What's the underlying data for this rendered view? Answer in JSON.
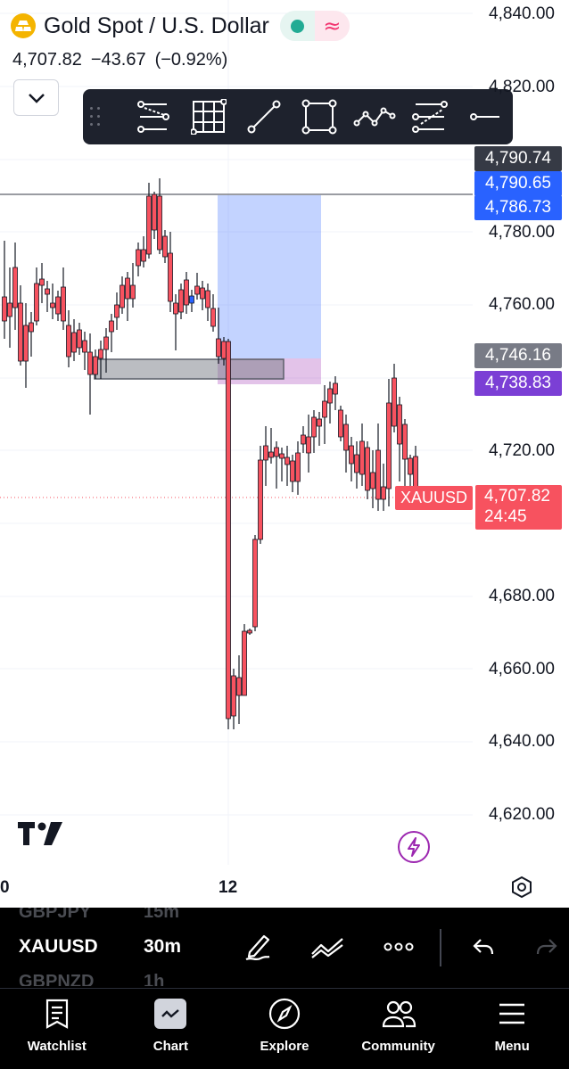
{
  "header": {
    "title": "Gold Spot / U.S. Dollar",
    "last": "4,707.82",
    "change": "−43.67",
    "change_pct": "(−0.92%)"
  },
  "price_axis": [
    "4,840.00",
    "4,820.00",
    "4,780.00",
    "4,760.00",
    "4,720.00",
    "4,680.00",
    "4,660.00",
    "4,640.00",
    "4,620.00"
  ],
  "tags": {
    "high_line": "4,790.74",
    "target_top": "4,790.65",
    "target_bottom": "4,786.73",
    "entry": "4,746.16",
    "stop": "4,738.83"
  },
  "current": {
    "symbol": "XAUUSD",
    "price": "4,707.82",
    "countdown": "24:45"
  },
  "time_axis": [
    "0",
    "12"
  ],
  "colors": {
    "up": "#2962ff",
    "down": "#f7525f",
    "dark_tag": "#363a45",
    "blue_tag": "#2962ff",
    "grey_tag": "#787b86",
    "purple_tag": "#7b3fd5"
  },
  "toolbar_icons": [
    "fib-retracement-icon",
    "gann-box-icon",
    "trend-line-icon",
    "rectangle-icon",
    "path-icon",
    "parallel-channel-icon",
    "horizontal-line-icon"
  ],
  "symbol_picker": [
    {
      "symbol": "GBPJPY",
      "interval": "15m"
    },
    {
      "symbol": "XAUUSD",
      "interval": "30m"
    },
    {
      "symbol": "GBPNZD",
      "interval": "1h"
    }
  ],
  "nav": [
    "Watchlist",
    "Chart",
    "Explore",
    "Community",
    "Menu"
  ]
}
